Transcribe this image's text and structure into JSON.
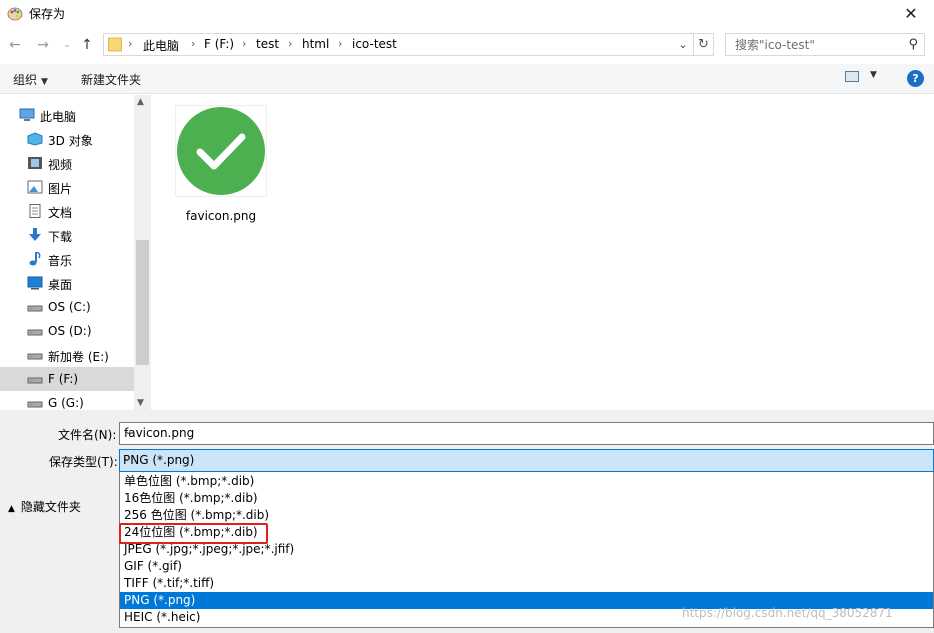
{
  "window": {
    "title": "保存为"
  },
  "address": {
    "crumbs": [
      "此电脑",
      "F (F:)",
      "test",
      "html",
      "ico-test"
    ]
  },
  "search": {
    "placeholder": "搜索\"ico-test\""
  },
  "toolbar": {
    "organize_label": "组织",
    "new_folder_label": "新建文件夹",
    "help_label": "?"
  },
  "navpane": {
    "items": [
      {
        "label": "此电脑",
        "icon": "computer-icon"
      },
      {
        "label": "3D 对象",
        "icon": "3d-objects-icon"
      },
      {
        "label": "视频",
        "icon": "video-icon"
      },
      {
        "label": "图片",
        "icon": "pictures-icon"
      },
      {
        "label": "文档",
        "icon": "documents-icon"
      },
      {
        "label": "下载",
        "icon": "download-icon"
      },
      {
        "label": "音乐",
        "icon": "music-icon"
      },
      {
        "label": "桌面",
        "icon": "desktop-icon"
      },
      {
        "label": "OS (C:)",
        "icon": "drive-icon"
      },
      {
        "label": "OS (D:)",
        "icon": "drive-icon"
      },
      {
        "label": "新加卷 (E:)",
        "icon": "drive-icon"
      },
      {
        "label": "F (F:)",
        "icon": "drive-icon",
        "selected": true
      },
      {
        "label": "G (G:)",
        "icon": "drive-icon"
      }
    ]
  },
  "content": {
    "files": [
      {
        "name": "favicon.png",
        "icon": "green-check-icon"
      }
    ]
  },
  "form": {
    "filename_label": "文件名(N):",
    "filename_value": "favicon.png",
    "filetype_label": "保存类型(T):",
    "filetype_value": "PNG (*.png)",
    "hide_folders_label": "隐藏文件夹"
  },
  "filetype_options": [
    "单色位图 (*.bmp;*.dib)",
    "16色位图 (*.bmp;*.dib)",
    "256 色位图 (*.bmp;*.dib)",
    "24位位图 (*.bmp;*.dib)",
    "JPEG (*.jpg;*.jpeg;*.jpe;*.jfif)",
    "GIF (*.gif)",
    "TIFF (*.tif;*.tiff)",
    "PNG (*.png)",
    "HEIC (*.heic)"
  ],
  "selected_option_index": 7,
  "highlighted_option_index": 3,
  "watermark": "https://blog.csdn.net/qq_38052871",
  "colors": {
    "accent": "#0078d7",
    "highlight_box": "#e0201a",
    "check_green": "#4caf50"
  }
}
